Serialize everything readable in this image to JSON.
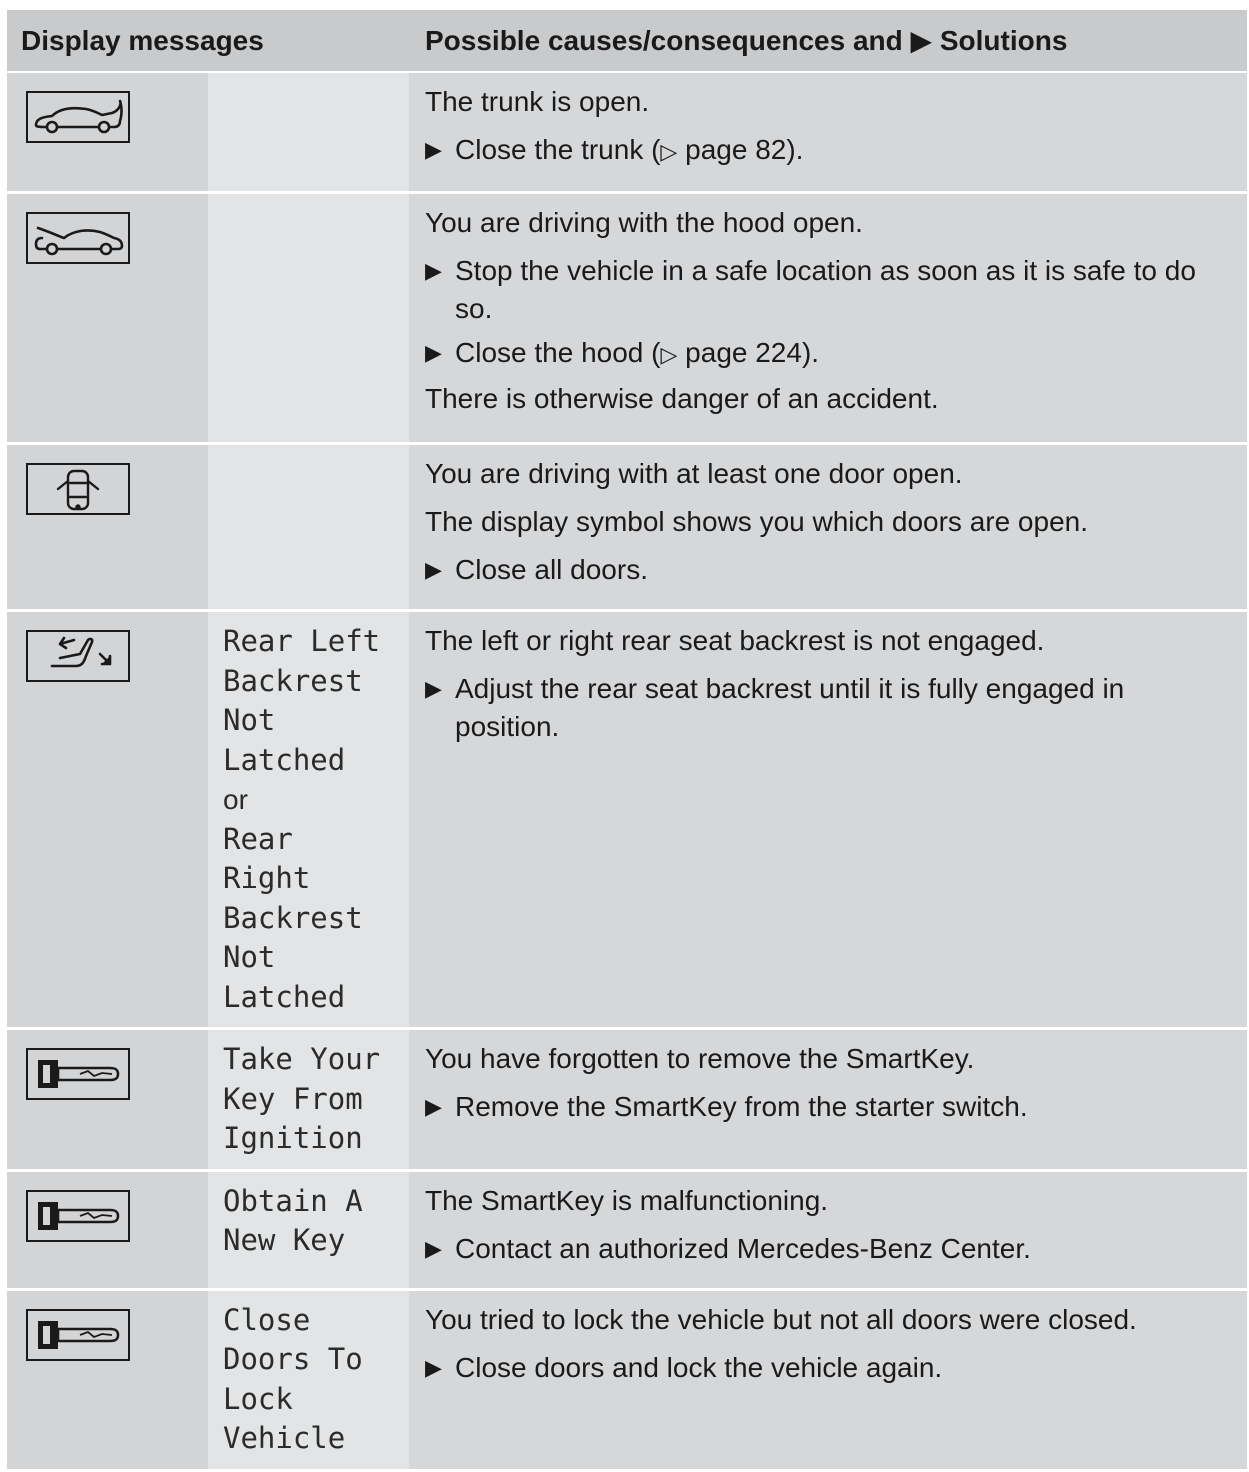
{
  "header": {
    "col1": "Display messages",
    "col2": "Possible causes/consequences and ▶ Solutions"
  },
  "rows": [
    {
      "icon": "trunk-open-icon",
      "message": [],
      "or": "",
      "message2": [],
      "paras": [
        "The trunk is open."
      ],
      "steps": [
        {
          "pre": "Close the trunk (",
          "ref": "▷",
          "post": " page 82)."
        }
      ],
      "after": ""
    },
    {
      "icon": "hood-open-icon",
      "message": [],
      "or": "",
      "message2": [],
      "paras": [
        "You are driving with the hood open."
      ],
      "steps": [
        {
          "pre": "Stop the vehicle in a safe location as soon as it is safe to do so.",
          "ref": "",
          "post": ""
        },
        {
          "pre": "Close the hood (",
          "ref": "▷",
          "post": " page 224)."
        }
      ],
      "after": "There is otherwise danger of an accident."
    },
    {
      "icon": "door-open-icon",
      "message": [],
      "or": "",
      "message2": [],
      "paras": [
        "You are driving with at least one door open.",
        "The display symbol shows you which doors are open."
      ],
      "steps": [
        {
          "pre": "Close all doors.",
          "ref": "",
          "post": ""
        }
      ],
      "after": ""
    },
    {
      "icon": "seat-backrest-icon",
      "message": [
        "Rear Left",
        "Backrest",
        "Not",
        "Latched"
      ],
      "or": "or",
      "message2": [
        "Rear",
        "Right",
        "Backrest",
        "Not",
        "Latched"
      ],
      "paras": [
        "The left or right rear seat backrest is not engaged."
      ],
      "steps": [
        {
          "pre": "Adjust the rear seat backrest until it is fully engaged in position.",
          "ref": "",
          "post": ""
        }
      ],
      "after": ""
    },
    {
      "icon": "smartkey-icon",
      "message": [
        "Take Your",
        "Key From",
        "Ignition"
      ],
      "or": "",
      "message2": [],
      "paras": [
        "You have forgotten to remove the SmartKey."
      ],
      "steps": [
        {
          "pre": "Remove the SmartKey from the starter switch.",
          "ref": "",
          "post": ""
        }
      ],
      "after": ""
    },
    {
      "icon": "smartkey-icon",
      "message": [
        "Obtain A",
        "New Key"
      ],
      "or": "",
      "message2": [],
      "paras": [
        "The SmartKey is malfunctioning."
      ],
      "steps": [
        {
          "pre": "Contact an authorized Mercedes-Benz Center.",
          "ref": "",
          "post": ""
        }
      ],
      "after": ""
    },
    {
      "icon": "smartkey-icon",
      "message": [
        "Close",
        "Doors To",
        "Lock",
        "Vehicle"
      ],
      "or": "",
      "message2": [],
      "paras": [
        "You tried to lock the vehicle but not all doors were closed."
      ],
      "steps": [
        {
          "pre": "Close doors and lock the vehicle again.",
          "ref": "",
          "post": ""
        }
      ],
      "after": ""
    }
  ],
  "bullet_glyph": "▶"
}
